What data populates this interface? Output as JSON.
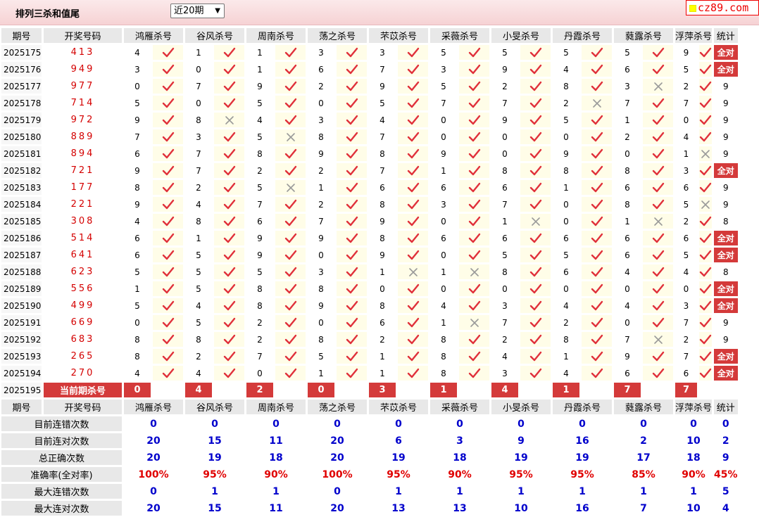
{
  "header": {
    "title": "排列三杀和值尾",
    "period_select": "近20期",
    "logo_text": "cz89.com"
  },
  "columns": {
    "period": "期号",
    "draw": "开奖号码",
    "experts": [
      "鸿雁杀号",
      "谷风杀号",
      "周南杀号",
      "荡之杀号",
      "芣苡杀号",
      "采薇杀号",
      "小旻杀号",
      "丹霞杀号",
      "蕤露杀号",
      "浮萍杀号"
    ],
    "stats": "统计"
  },
  "all_correct_label": "全对",
  "rows": [
    {
      "period": "2025175",
      "draw": "413",
      "kills": [
        "4",
        "1",
        "1",
        "3",
        "3",
        "5",
        "5",
        "5",
        "5",
        "9"
      ],
      "ok": [
        1,
        1,
        1,
        1,
        1,
        1,
        1,
        1,
        1,
        1
      ],
      "stat": "全对"
    },
    {
      "period": "2025176",
      "draw": "949",
      "kills": [
        "3",
        "0",
        "1",
        "6",
        "7",
        "3",
        "9",
        "4",
        "6",
        "5"
      ],
      "ok": [
        1,
        1,
        1,
        1,
        1,
        1,
        1,
        1,
        1,
        1
      ],
      "stat": "全对"
    },
    {
      "period": "2025177",
      "draw": "977",
      "kills": [
        "0",
        "7",
        "9",
        "2",
        "9",
        "5",
        "2",
        "8",
        "3",
        "2"
      ],
      "ok": [
        1,
        1,
        1,
        1,
        1,
        1,
        1,
        1,
        0,
        1
      ],
      "stat": "9"
    },
    {
      "period": "2025178",
      "draw": "714",
      "kills": [
        "5",
        "0",
        "5",
        "0",
        "5",
        "7",
        "7",
        "2",
        "7",
        "7"
      ],
      "ok": [
        1,
        1,
        1,
        1,
        1,
        1,
        1,
        0,
        1,
        1
      ],
      "stat": "9"
    },
    {
      "period": "2025179",
      "draw": "972",
      "kills": [
        "9",
        "8",
        "4",
        "3",
        "4",
        "0",
        "9",
        "5",
        "1",
        "0"
      ],
      "ok": [
        1,
        0,
        1,
        1,
        1,
        1,
        1,
        1,
        1,
        1
      ],
      "stat": "9"
    },
    {
      "period": "2025180",
      "draw": "889",
      "kills": [
        "7",
        "3",
        "5",
        "8",
        "7",
        "0",
        "0",
        "0",
        "2",
        "4"
      ],
      "ok": [
        1,
        1,
        0,
        1,
        1,
        1,
        1,
        1,
        1,
        1
      ],
      "stat": "9"
    },
    {
      "period": "2025181",
      "draw": "894",
      "kills": [
        "6",
        "7",
        "8",
        "9",
        "8",
        "9",
        "0",
        "9",
        "0",
        "1"
      ],
      "ok": [
        1,
        1,
        1,
        1,
        1,
        1,
        1,
        1,
        1,
        0
      ],
      "stat": "9"
    },
    {
      "period": "2025182",
      "draw": "721",
      "kills": [
        "9",
        "7",
        "2",
        "2",
        "7",
        "1",
        "8",
        "8",
        "8",
        "3"
      ],
      "ok": [
        1,
        1,
        1,
        1,
        1,
        1,
        1,
        1,
        1,
        1
      ],
      "stat": "全对"
    },
    {
      "period": "2025183",
      "draw": "177",
      "kills": [
        "8",
        "2",
        "5",
        "1",
        "6",
        "6",
        "6",
        "1",
        "6",
        "6"
      ],
      "ok": [
        1,
        1,
        0,
        1,
        1,
        1,
        1,
        1,
        1,
        1
      ],
      "stat": "9"
    },
    {
      "period": "2025184",
      "draw": "221",
      "kills": [
        "9",
        "4",
        "7",
        "2",
        "8",
        "3",
        "7",
        "0",
        "8",
        "5"
      ],
      "ok": [
        1,
        1,
        1,
        1,
        1,
        1,
        1,
        1,
        1,
        0
      ],
      "stat": "9"
    },
    {
      "period": "2025185",
      "draw": "308",
      "kills": [
        "4",
        "8",
        "6",
        "7",
        "9",
        "0",
        "1",
        "0",
        "1",
        "2"
      ],
      "ok": [
        1,
        1,
        1,
        1,
        1,
        1,
        0,
        1,
        0,
        1
      ],
      "stat": "8"
    },
    {
      "period": "2025186",
      "draw": "514",
      "kills": [
        "6",
        "1",
        "9",
        "9",
        "8",
        "6",
        "6",
        "6",
        "6",
        "6"
      ],
      "ok": [
        1,
        1,
        1,
        1,
        1,
        1,
        1,
        1,
        1,
        1
      ],
      "stat": "全对"
    },
    {
      "period": "2025187",
      "draw": "641",
      "kills": [
        "6",
        "5",
        "9",
        "0",
        "9",
        "0",
        "5",
        "5",
        "6",
        "5"
      ],
      "ok": [
        1,
        1,
        1,
        1,
        1,
        1,
        1,
        1,
        1,
        1
      ],
      "stat": "全对"
    },
    {
      "period": "2025188",
      "draw": "623",
      "kills": [
        "5",
        "5",
        "5",
        "3",
        "1",
        "1",
        "8",
        "6",
        "4",
        "4"
      ],
      "ok": [
        1,
        1,
        1,
        1,
        0,
        0,
        1,
        1,
        1,
        1
      ],
      "stat": "8"
    },
    {
      "period": "2025189",
      "draw": "556",
      "kills": [
        "1",
        "5",
        "8",
        "8",
        "0",
        "0",
        "0",
        "0",
        "0",
        "0"
      ],
      "ok": [
        1,
        1,
        1,
        1,
        1,
        1,
        1,
        1,
        1,
        1
      ],
      "stat": "全对"
    },
    {
      "period": "2025190",
      "draw": "499",
      "kills": [
        "5",
        "4",
        "8",
        "9",
        "8",
        "4",
        "3",
        "4",
        "4",
        "3"
      ],
      "ok": [
        1,
        1,
        1,
        1,
        1,
        1,
        1,
        1,
        1,
        1
      ],
      "stat": "全对"
    },
    {
      "period": "2025191",
      "draw": "669",
      "kills": [
        "0",
        "5",
        "2",
        "0",
        "6",
        "1",
        "7",
        "2",
        "0",
        "7"
      ],
      "ok": [
        1,
        1,
        1,
        1,
        1,
        0,
        1,
        1,
        1,
        1
      ],
      "stat": "9"
    },
    {
      "period": "2025192",
      "draw": "683",
      "kills": [
        "8",
        "8",
        "2",
        "8",
        "2",
        "8",
        "2",
        "8",
        "7",
        "2"
      ],
      "ok": [
        1,
        1,
        1,
        1,
        1,
        1,
        1,
        1,
        0,
        1
      ],
      "stat": "9"
    },
    {
      "period": "2025193",
      "draw": "265",
      "kills": [
        "8",
        "2",
        "7",
        "5",
        "1",
        "8",
        "4",
        "1",
        "9",
        "7"
      ],
      "ok": [
        1,
        1,
        1,
        1,
        1,
        1,
        1,
        1,
        1,
        1
      ],
      "stat": "全对"
    },
    {
      "period": "2025194",
      "draw": "270",
      "kills": [
        "4",
        "4",
        "0",
        "1",
        "1",
        "8",
        "3",
        "4",
        "6",
        "6"
      ],
      "ok": [
        1,
        1,
        1,
        1,
        1,
        1,
        1,
        1,
        1,
        1
      ],
      "stat": "全对"
    }
  ],
  "current": {
    "period": "2025195",
    "label": "当前期杀号",
    "kills": [
      "0",
      "4",
      "2",
      "0",
      "3",
      "1",
      "4",
      "1",
      "7",
      "7"
    ]
  },
  "stats": [
    {
      "label": "目前连错次数",
      "values": [
        "0",
        "0",
        "0",
        "0",
        "0",
        "0",
        "0",
        "0",
        "0",
        "0"
      ],
      "total": "0"
    },
    {
      "label": "目前连对次数",
      "values": [
        "20",
        "15",
        "11",
        "20",
        "6",
        "3",
        "9",
        "16",
        "2",
        "10"
      ],
      "total": "2"
    },
    {
      "label": "总正确次数",
      "values": [
        "20",
        "19",
        "18",
        "20",
        "19",
        "18",
        "19",
        "19",
        "17",
        "18"
      ],
      "total": "9"
    },
    {
      "label": "准确率(全对率)",
      "values": [
        "100%",
        "95%",
        "90%",
        "100%",
        "95%",
        "90%",
        "95%",
        "95%",
        "85%",
        "90%"
      ],
      "total": "45%"
    },
    {
      "label": "最大连错次数",
      "values": [
        "0",
        "1",
        "1",
        "0",
        "1",
        "1",
        "1",
        "1",
        "1",
        "1"
      ],
      "total": "5"
    },
    {
      "label": "最大连对次数",
      "values": [
        "20",
        "15",
        "11",
        "20",
        "13",
        "13",
        "10",
        "16",
        "7",
        "10"
      ],
      "total": "4"
    }
  ],
  "colors": {
    "accent": "#d43a3a",
    "header_bg": "#e8e8e8",
    "mark_bg": "#fffde8",
    "draw": "#d40000",
    "stat_value": "#0000cc",
    "percent": "#e00000"
  },
  "icons": {
    "correct": "check-icon",
    "wrong": "cross-icon"
  }
}
